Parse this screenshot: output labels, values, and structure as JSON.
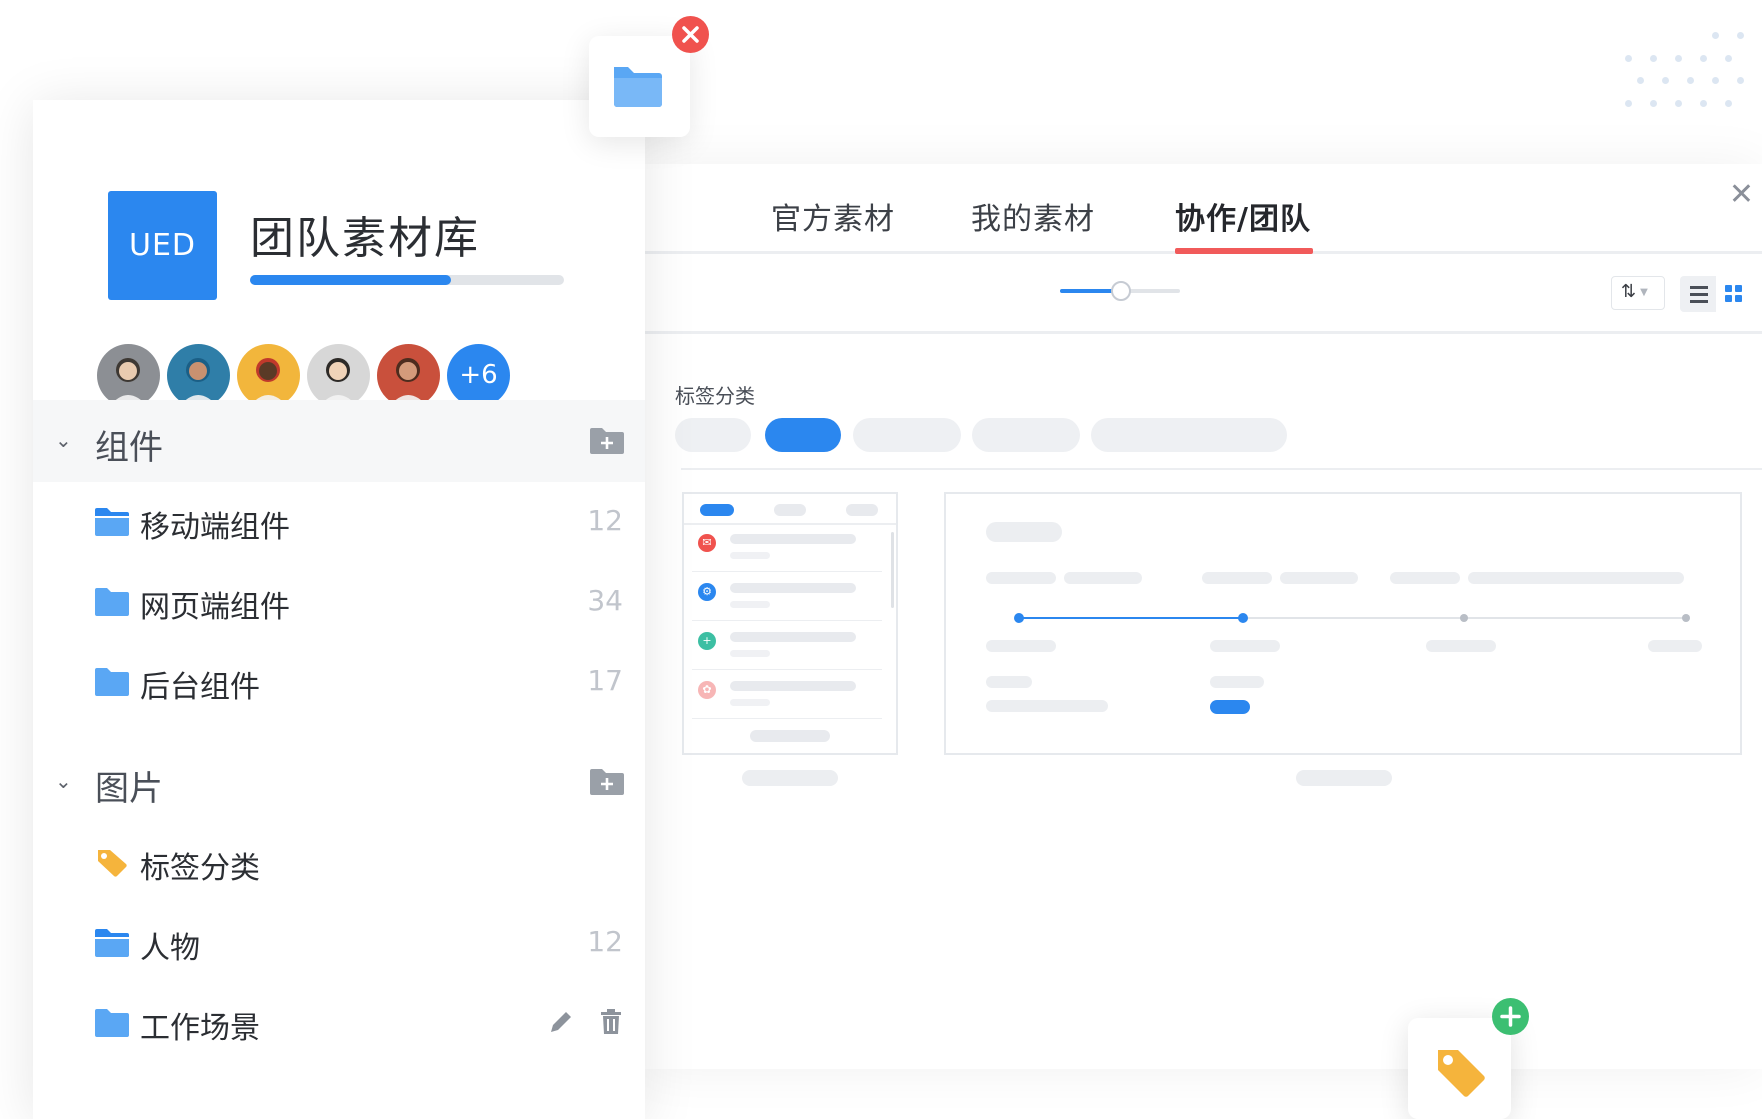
{
  "library": {
    "badge": "UED",
    "title": "团队素材库",
    "progress": 0.64,
    "more_members": "+6",
    "members": [
      {
        "name": "member-1",
        "color": "#8c8f94"
      },
      {
        "name": "member-2",
        "color": "#2f7ea8"
      },
      {
        "name": "member-3",
        "color": "#f2b63c"
      },
      {
        "name": "member-4",
        "color": "#d7d7d7"
      },
      {
        "name": "member-5",
        "color": "#c9503c"
      }
    ]
  },
  "groups": [
    {
      "title": "组件",
      "highlight": true,
      "items": [
        {
          "label": "移动端组件",
          "count": "12",
          "icon": "folder-open-icon"
        },
        {
          "label": "网页端组件",
          "count": "34",
          "icon": "folder-icon"
        },
        {
          "label": "后台组件",
          "count": "17",
          "icon": "folder-icon"
        }
      ]
    },
    {
      "title": "图片",
      "highlight": false,
      "items": [
        {
          "label": "标签分类",
          "count": "",
          "icon": "tag-icon"
        },
        {
          "label": "人物",
          "count": "12",
          "icon": "folder-open-icon"
        },
        {
          "label": "工作场景",
          "count": "",
          "icon": "folder-icon",
          "actions": [
            "edit-icon",
            "delete-icon"
          ]
        }
      ]
    }
  ],
  "main": {
    "tabs": [
      "官方素材",
      "我的素材",
      "协作/团队"
    ],
    "active_tab": 2,
    "zoom_level": 0.5,
    "section_label": "标签分类",
    "active_pill": 1
  },
  "colors": {
    "accent": "#2b87ef",
    "tab_underline": "#f15a5a",
    "close_badge": "#f0524e",
    "add_badge": "#3cbf72",
    "tag": "#f5b43c"
  }
}
